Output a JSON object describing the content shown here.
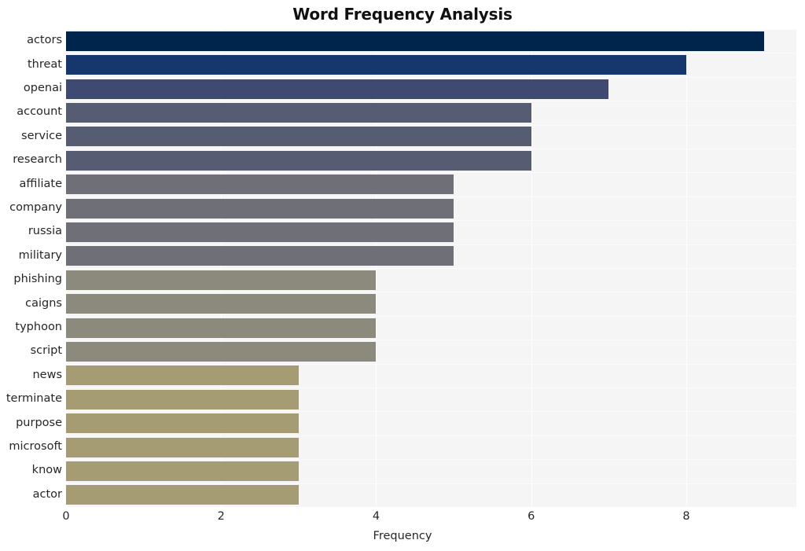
{
  "chart_data": {
    "type": "bar",
    "orientation": "horizontal",
    "title": "Word Frequency Analysis",
    "xlabel": "Frequency",
    "ylabel": "",
    "categories": [
      "actors",
      "threat",
      "openai",
      "account",
      "service",
      "research",
      "affiliate",
      "company",
      "russia",
      "military",
      "phishing",
      "caigns",
      "typhoon",
      "script",
      "news",
      "terminate",
      "purpose",
      "microsoft",
      "know",
      "actor"
    ],
    "values": [
      9,
      8,
      7,
      6,
      6,
      6,
      5,
      5,
      5,
      5,
      4,
      4,
      4,
      4,
      3,
      3,
      3,
      3,
      3,
      3
    ],
    "bar_colors": [
      "#00254d",
      "#16366e",
      "#3e4a72",
      "#565c72",
      "#565c72",
      "#565c72",
      "#6f7077",
      "#6f7077",
      "#6f7077",
      "#6f7077",
      "#8b8a7c",
      "#8b8a7c",
      "#8b8a7c",
      "#8b8a7c",
      "#a59c73",
      "#a59c73",
      "#a59c73",
      "#a59c73",
      "#a59c73",
      "#a59c73"
    ],
    "xticks": [
      0,
      2,
      4,
      6,
      8
    ],
    "xtick_labels": [
      "0",
      "2",
      "4",
      "6",
      "8"
    ],
    "xlim": [
      0,
      9.42
    ],
    "grid": true,
    "grid_axis": "both",
    "legend": false,
    "plot_background": "#f5f5f6",
    "figure_background": "#ffffff",
    "grid_color": "#ffffff",
    "text_color": "#262626",
    "title_color": "#111111"
  }
}
